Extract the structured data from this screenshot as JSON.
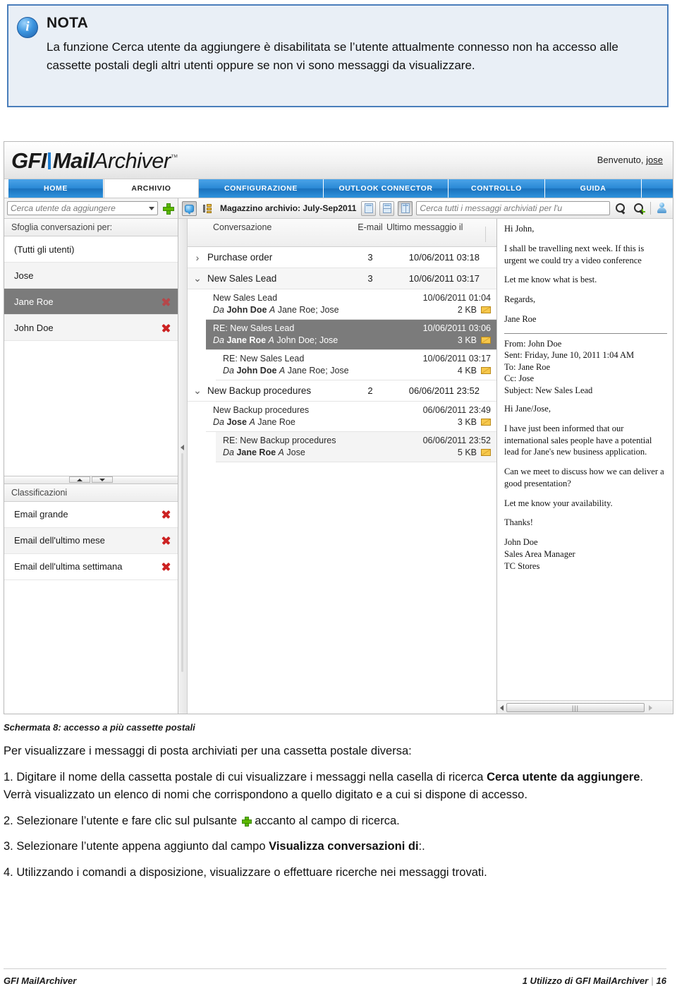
{
  "note": {
    "icon": "info-icon",
    "title": "NOTA",
    "text": "La funzione Cerca utente da aggiungere è disabilitata se l’utente attualmente connesso non ha accesso alle cassette postali degli altri utenti oppure se non vi sono messaggi da visualizzare."
  },
  "app": {
    "logo": {
      "gfi": "GFI",
      "mail": "Mail",
      "archiver": "Archiver"
    },
    "welcome": {
      "label": "Benvenuto,",
      "user": "jose"
    },
    "nav_tabs": [
      {
        "label": "HOME",
        "active": false
      },
      {
        "label": "ARCHIVIO",
        "active": true
      },
      {
        "label": "CONFIGURAZIONE",
        "active": false
      },
      {
        "label": "OUTLOOK CONNECTOR",
        "active": false
      },
      {
        "label": "CONTROLLO",
        "active": false
      },
      {
        "label": "GUIDA",
        "active": false
      }
    ],
    "toolbar": {
      "user_search_placeholder": "Cerca utente da aggiungere",
      "add_user_button": "add-user-plus",
      "archive_store_label": "Magazzino archivio: July-Sep2011",
      "global_search_placeholder": "Cerca tutti i messaggi archiviati per l'u"
    },
    "sidebar": {
      "browse_header": "Sfoglia conversazioni per:",
      "users": [
        {
          "label": "(Tutti gli utenti)",
          "removable": false,
          "selected": false
        },
        {
          "label": "Jose",
          "removable": false,
          "selected": false
        },
        {
          "label": "Jane Roe",
          "removable": true,
          "selected": true
        },
        {
          "label": "John Doe",
          "removable": true,
          "selected": false
        }
      ],
      "classifications_header": "Classificazioni",
      "classifications": [
        {
          "label": "Email grande",
          "removable": true
        },
        {
          "label": "Email dell'ultimo mese",
          "removable": true
        },
        {
          "label": "Email dell'ultima settimana",
          "removable": true
        }
      ]
    },
    "conversation_list": {
      "columns": {
        "conversation": "Conversazione",
        "email": "E-mail",
        "last_message": "Ultimo messaggio il"
      },
      "rows": [
        {
          "type": "conversation",
          "expanded": false,
          "title": "Purchase order",
          "count": "3",
          "date": "10/06/2011 03:18",
          "messages": []
        },
        {
          "type": "conversation",
          "expanded": true,
          "title": "New Sales Lead",
          "count": "3",
          "date": "10/06/2011 03:17",
          "messages": [
            {
              "subject": "New Sales Lead",
              "date": "10/06/2011 01:04",
              "from_label": "Da",
              "from": "John Doe",
              "to_label": "A",
              "to": "Jane Roe; Jose",
              "size": "2 KB",
              "selected": false,
              "indent": false
            },
            {
              "subject": "RE: New Sales Lead",
              "date": "10/06/2011 03:06",
              "from_label": "Da",
              "from": "Jane Roe",
              "to_label": "A",
              "to": "John Doe; Jose",
              "size": "3 KB",
              "selected": true,
              "indent": false
            },
            {
              "subject": "RE: New Sales Lead",
              "date": "10/06/2011 03:17",
              "from_label": "Da",
              "from": "John Doe",
              "to_label": "A",
              "to": "Jane Roe; Jose",
              "size": "4 KB",
              "selected": false,
              "indent": true
            }
          ]
        },
        {
          "type": "conversation",
          "expanded": true,
          "title": "New Backup procedures",
          "count": "2",
          "date": "06/06/2011 23:52",
          "messages": [
            {
              "subject": "New Backup procedures",
              "date": "06/06/2011 23:49",
              "from_label": "Da",
              "from": "Jose",
              "to_label": "A",
              "to": "Jane Roe",
              "size": "3 KB",
              "selected": false,
              "indent": false
            },
            {
              "subject": "RE: New Backup procedures",
              "date": "06/06/2011 23:52",
              "from_label": "Da",
              "from": "Jane Roe",
              "to_label": "A",
              "to": "Jose",
              "size": "5 KB",
              "selected": false,
              "indent": true
            }
          ]
        }
      ]
    },
    "reading_pane": {
      "reply_body": [
        "Hi John,",
        "I shall be travelling next week. If this is urgent we could try a video conference",
        "Let me know what is best.",
        "Regards,",
        "Jane Roe"
      ],
      "quoted_headers": {
        "from": "From: John Doe",
        "sent": "Sent: Friday, June 10, 2011 1:04 AM",
        "to": "To: Jane Roe",
        "cc": "Cc: Jose",
        "subject": "Subject: New Sales Lead"
      },
      "quoted_body": [
        "Hi Jane/Jose,",
        "I have just been informed that our international sales people have a potential lead for Jane's new business application.",
        "Can we meet to discuss how we can deliver a good presentation?",
        "Let me know your availability.",
        "Thanks!",
        "John Doe",
        "Sales Area Manager",
        "TC Stores"
      ]
    }
  },
  "document": {
    "caption": "Schermata  8: accesso a più cassette postali",
    "intro": "Per visualizzare i messaggi di posta archiviati per una cassetta postale diversa:",
    "step1_a": "1. Digitare il nome della cassetta postale di cui visualizzare i messaggi nella casella di ricerca ",
    "step1_b": "Cerca utente da aggiungere",
    "step1_c": ". Verrà visualizzato un elenco di nomi che corrispondono a quello digitato e a cui si dispone di accesso.",
    "step2_a": "2. Selezionare l’utente e fare clic sul pulsante ",
    "step2_b": " accanto al campo di ricerca.",
    "step3_a": "3. Selezionare l’utente appena aggiunto dal campo ",
    "step3_b": "Visualizza conversazioni di",
    "step3_c": ":.",
    "step4": "4. Utilizzando i comandi a disposizione, visualizzare o effettuare ricerche nei messaggi trovati."
  },
  "footer": {
    "left": "GFI MailArchiver",
    "right_title": "1 Utilizzo di GFI MailArchiver",
    "page": "16"
  }
}
